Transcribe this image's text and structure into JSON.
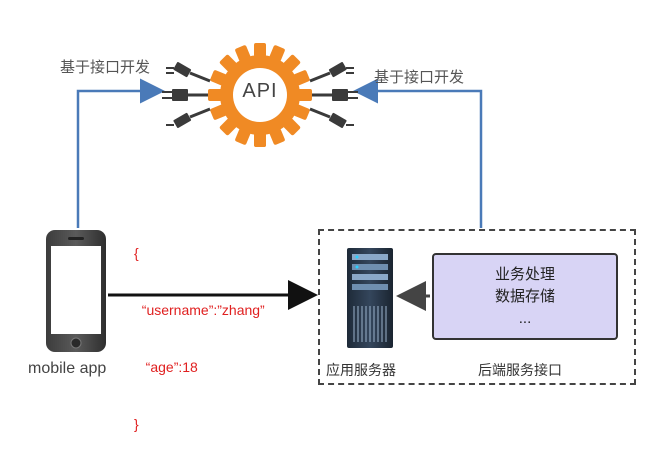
{
  "api": {
    "label": "API"
  },
  "left_arrow": {
    "label": "基于接口开发"
  },
  "right_arrow": {
    "label": "基于接口开发"
  },
  "json_payload": {
    "lines": [
      "{",
      "  “username”:”zhang”",
      "   “age”:18",
      "}"
    ]
  },
  "mobile": {
    "label": "mobile app"
  },
  "server": {
    "label": "应用服务器"
  },
  "backend": {
    "label": "后端服务接口",
    "items": [
      "业务处理",
      "数据存储",
      "..."
    ]
  },
  "colors": {
    "arrow_blue": "#4a7ab8",
    "gear_orange": "#f08a24",
    "json_red": "#e02020",
    "box_fill": "#d8d4f5"
  }
}
